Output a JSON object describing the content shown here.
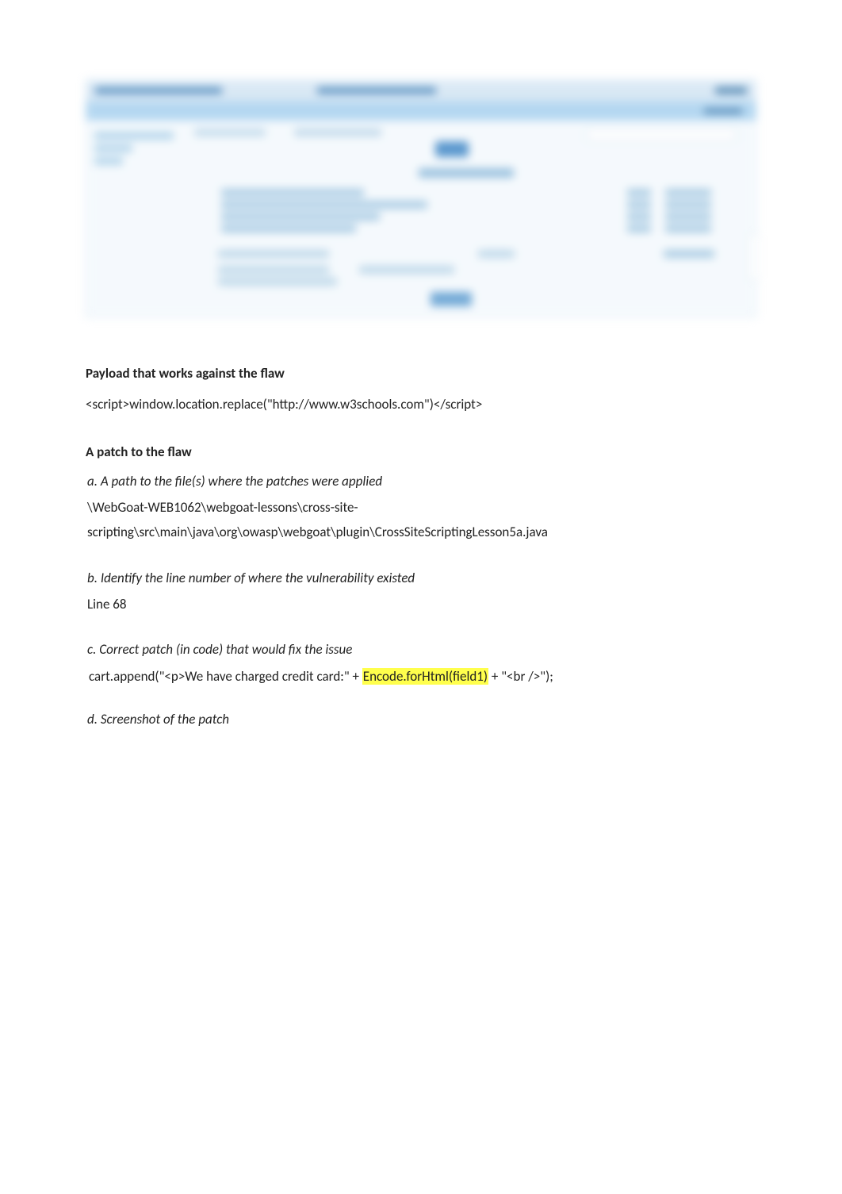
{
  "sections": {
    "payload_heading": "Payload that works against the flaw",
    "payload_code": "<script>window.location.replace(\"http://www.w3schools.com\")</script>",
    "patch_heading": "A patch to the flaw",
    "a": {
      "label": "a. A path to the file(s) where the patches were applied",
      "path_line1": "\\WebGoat-WEB1062\\webgoat-lessons\\cross-site-",
      "path_line2": "scripting\\src\\main\\java\\org\\owasp\\webgoat\\plugin\\CrossSiteScriptingLesson5a.java"
    },
    "b": {
      "label": "b. Identify the line number of where the vulnerability existed",
      "value": "Line 68"
    },
    "c": {
      "label": "c.  Correct patch (in code) that would fix the issue",
      "code_pre": "cart.append(\"<p>We have charged credit card:\" + ",
      "code_hl": "Encode.forHtml(field1)",
      "code_post": " + \"<br />\");"
    },
    "d": {
      "label": "d. Screenshot of the patch"
    }
  }
}
